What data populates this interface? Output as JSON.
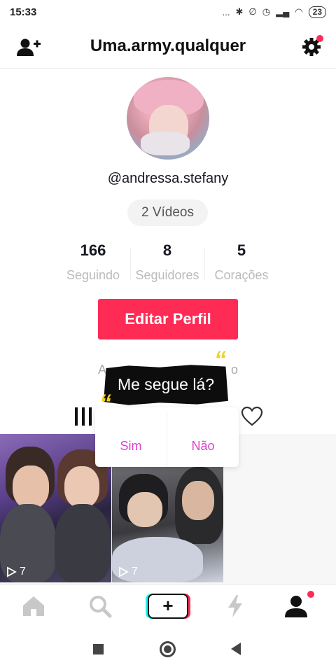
{
  "status_bar": {
    "time": "15:33",
    "dots": "...",
    "battery": "23"
  },
  "header": {
    "title": "Uma.army.qualquer"
  },
  "profile": {
    "username": "@andressa.stefany",
    "videos_label": "2 Vídeos",
    "stats": [
      {
        "value": "166",
        "label": "Seguindo"
      },
      {
        "value": "8",
        "label": "Seguidores"
      },
      {
        "value": "5",
        "label": "Corações"
      }
    ],
    "edit_button": "Editar Perfil",
    "bio_partial_left": "A",
    "bio_partial_right": "o"
  },
  "sticker": {
    "text": "Me segue lá?",
    "quote_mark": "“"
  },
  "popup": {
    "yes": "Sim",
    "no": "Não"
  },
  "videos": [
    {
      "play_count": "7"
    },
    {
      "play_count": "7"
    }
  ],
  "colors": {
    "accent": "#fe2c55",
    "popup_text": "#e040d0",
    "cyan": "#25f4ee"
  },
  "icons": [
    "add-user-icon",
    "gear-icon",
    "grid-icon",
    "heart-icon",
    "home-icon",
    "search-icon",
    "plus-icon",
    "flash-icon",
    "profile-icon"
  ]
}
